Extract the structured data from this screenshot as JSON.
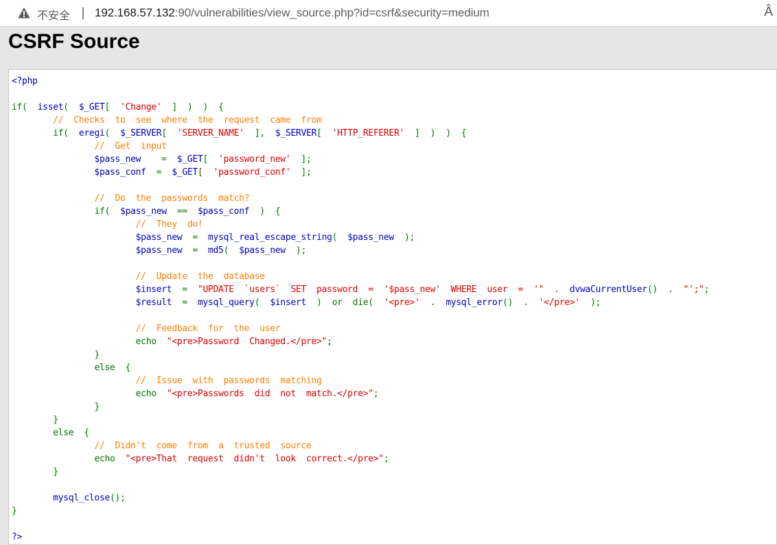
{
  "browser": {
    "security_label": "不安全",
    "separator": "|",
    "url_host": "192.168.57.132",
    "url_rest": ":90/vulnerabilities/view_source.php?id=csrf&security=medium",
    "reader_icon": "Â"
  },
  "page": {
    "title": "CSRF Source"
  },
  "colors": {
    "keyword": "#007700",
    "string": "#dd0000",
    "comment": "#ff8000",
    "default": "#0000bb"
  },
  "code": [
    [
      [
        "d",
        "<?php"
      ]
    ],
    [],
    [
      [
        "k",
        "if(  "
      ],
      [
        "d",
        "isset"
      ],
      [
        "k",
        "(  "
      ],
      [
        "d",
        "$_GET"
      ],
      [
        "k",
        "[  "
      ],
      [
        "s",
        "'Change'"
      ],
      [
        "k",
        "  ]  )  )  {"
      ]
    ],
    [
      [
        "d",
        "        "
      ],
      [
        "c",
        "//  Checks  to  see  where  the  request  came  from"
      ]
    ],
    [
      [
        "d",
        "        "
      ],
      [
        "k",
        "if(  "
      ],
      [
        "d",
        "eregi"
      ],
      [
        "k",
        "(  "
      ],
      [
        "d",
        "$_SERVER"
      ],
      [
        "k",
        "[  "
      ],
      [
        "s",
        "'SERVER_NAME'"
      ],
      [
        "k",
        "  ],  "
      ],
      [
        "d",
        "$_SERVER"
      ],
      [
        "k",
        "[  "
      ],
      [
        "s",
        "'HTTP_REFERER'"
      ],
      [
        "k",
        "  ]  )  )  {"
      ]
    ],
    [
      [
        "d",
        "                "
      ],
      [
        "c",
        "//  Get  input"
      ]
    ],
    [
      [
        "d",
        "                $pass_new    "
      ],
      [
        "k",
        "=  "
      ],
      [
        "d",
        "$_GET"
      ],
      [
        "k",
        "[  "
      ],
      [
        "s",
        "'password_new'"
      ],
      [
        "k",
        "  ];"
      ]
    ],
    [
      [
        "d",
        "                $pass_conf  "
      ],
      [
        "k",
        "=  "
      ],
      [
        "d",
        "$_GET"
      ],
      [
        "k",
        "[  "
      ],
      [
        "s",
        "'password_conf'"
      ],
      [
        "k",
        "  ];"
      ]
    ],
    [],
    [
      [
        "d",
        "                "
      ],
      [
        "c",
        "//  Do  the  passwords  match?"
      ]
    ],
    [
      [
        "d",
        "                "
      ],
      [
        "k",
        "if(  "
      ],
      [
        "d",
        "$pass_new  "
      ],
      [
        "k",
        "==  "
      ],
      [
        "d",
        "$pass_conf  "
      ],
      [
        "k",
        ")  {"
      ]
    ],
    [
      [
        "d",
        "                        "
      ],
      [
        "c",
        "//  They  do!"
      ]
    ],
    [
      [
        "d",
        "                        $pass_new  "
      ],
      [
        "k",
        "=  "
      ],
      [
        "d",
        "mysql_real_escape_string"
      ],
      [
        "k",
        "(  "
      ],
      [
        "d",
        "$pass_new  "
      ],
      [
        "k",
        ");"
      ]
    ],
    [
      [
        "d",
        "                        $pass_new  "
      ],
      [
        "k",
        "=  "
      ],
      [
        "d",
        "md5"
      ],
      [
        "k",
        "(  "
      ],
      [
        "d",
        "$pass_new  "
      ],
      [
        "k",
        ");"
      ]
    ],
    [],
    [
      [
        "d",
        "                        "
      ],
      [
        "c",
        "//  Update  the  database"
      ]
    ],
    [
      [
        "d",
        "                        $insert  "
      ],
      [
        "k",
        "=  "
      ],
      [
        "s",
        "\"UPDATE  `users`  SET  password  =  '$pass_new'  WHERE  user  =  '\""
      ],
      [
        "k",
        "  .  "
      ],
      [
        "d",
        "dvwaCurrentUser"
      ],
      [
        "k",
        "()  .  "
      ],
      [
        "s",
        "\"';\""
      ],
      [
        "k",
        ";"
      ]
    ],
    [
      [
        "d",
        "                        $result  "
      ],
      [
        "k",
        "=  "
      ],
      [
        "d",
        "mysql_query"
      ],
      [
        "k",
        "(  "
      ],
      [
        "d",
        "$insert  "
      ],
      [
        "k",
        ")  or  die(  "
      ],
      [
        "s",
        "'<pre>'"
      ],
      [
        "k",
        "  .  "
      ],
      [
        "d",
        "mysql_error"
      ],
      [
        "k",
        "()  .  "
      ],
      [
        "s",
        "'</pre>'"
      ],
      [
        "k",
        "  );"
      ]
    ],
    [],
    [
      [
        "d",
        "                        "
      ],
      [
        "c",
        "//  Feedback  for  the  user"
      ]
    ],
    [
      [
        "d",
        "                        "
      ],
      [
        "k",
        "echo  "
      ],
      [
        "s",
        "\"<pre>Password  Changed.</pre>\""
      ],
      [
        "k",
        ";"
      ]
    ],
    [
      [
        "d",
        "                "
      ],
      [
        "k",
        "}"
      ]
    ],
    [
      [
        "d",
        "                "
      ],
      [
        "k",
        "else  {"
      ]
    ],
    [
      [
        "d",
        "                        "
      ],
      [
        "c",
        "//  Issue  with  passwords  matching"
      ]
    ],
    [
      [
        "d",
        "                        "
      ],
      [
        "k",
        "echo  "
      ],
      [
        "s",
        "\"<pre>Passwords  did  not  match.</pre>\""
      ],
      [
        "k",
        ";"
      ]
    ],
    [
      [
        "d",
        "                "
      ],
      [
        "k",
        "}"
      ]
    ],
    [
      [
        "d",
        "        "
      ],
      [
        "k",
        "}"
      ]
    ],
    [
      [
        "d",
        "        "
      ],
      [
        "k",
        "else  {"
      ]
    ],
    [
      [
        "d",
        "                "
      ],
      [
        "c",
        "//  Didn't  come  from  a  trusted  source"
      ]
    ],
    [
      [
        "d",
        "                "
      ],
      [
        "k",
        "echo  "
      ],
      [
        "s",
        "\"<pre>That  request  didn't  look  correct.</pre>\""
      ],
      [
        "k",
        ";"
      ]
    ],
    [
      [
        "d",
        "        "
      ],
      [
        "k",
        "}"
      ]
    ],
    [],
    [
      [
        "d",
        "        mysql_close"
      ],
      [
        "k",
        "();"
      ]
    ],
    [
      [
        "k",
        "}"
      ]
    ],
    [],
    [
      [
        "d",
        "?>"
      ]
    ]
  ]
}
